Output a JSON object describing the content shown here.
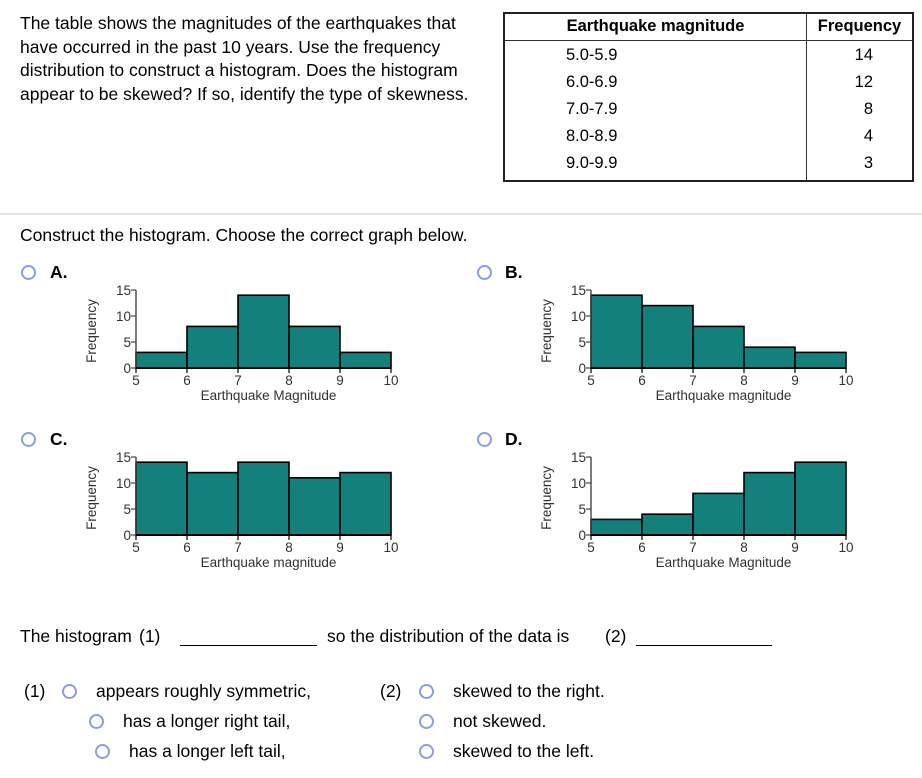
{
  "question": {
    "intro": "The table shows the magnitudes of the earthquakes that have occurred in the past 10 years. Use the frequency distribution to construct a histogram. Does the histogram appear to be skewed? If so, identify the type of skewness.",
    "instruction": "Construct the histogram. Choose the correct graph below."
  },
  "table": {
    "headers": [
      "Earthquake magnitude",
      "Frequency"
    ],
    "rows": [
      {
        "magnitude": "5.0-5.9",
        "frequency": "14"
      },
      {
        "magnitude": "6.0-6.9",
        "frequency": "12"
      },
      {
        "magnitude": "7.0-7.9",
        "frequency": "8"
      },
      {
        "magnitude": "8.0-8.9",
        "frequency": "4"
      },
      {
        "magnitude": "9.0-9.9",
        "frequency": "3"
      }
    ]
  },
  "options": [
    {
      "label": "A.",
      "selected": false
    },
    {
      "label": "B.",
      "selected": false
    },
    {
      "label": "C.",
      "selected": false
    },
    {
      "label": "D.",
      "selected": false
    }
  ],
  "chart_data": [
    {
      "type": "bar",
      "option": "A",
      "bin_edges": [
        5,
        6,
        7,
        8,
        9,
        10
      ],
      "values": [
        3,
        8,
        14,
        8,
        3
      ],
      "xlabel": "Earthquake Magnitude",
      "ylabel": "Frequency",
      "xlim": [
        5,
        10
      ],
      "ylim": [
        0,
        15
      ],
      "xticks": [
        "5",
        "6",
        "7",
        "8",
        "9",
        "10"
      ],
      "yticks": [
        "0",
        "5",
        "10",
        "15"
      ],
      "bar_color": "#13807b",
      "grid": false
    },
    {
      "type": "bar",
      "option": "B",
      "bin_edges": [
        5,
        6,
        7,
        8,
        9,
        10
      ],
      "values": [
        14,
        12,
        8,
        4,
        3
      ],
      "xlabel": "Earthquake magnitude",
      "ylabel": "Frequency",
      "xlim": [
        5,
        10
      ],
      "ylim": [
        0,
        15
      ],
      "xticks": [
        "5",
        "6",
        "7",
        "8",
        "9",
        "10"
      ],
      "yticks": [
        "0",
        "5",
        "10",
        "15"
      ],
      "bar_color": "#13807b",
      "grid": false
    },
    {
      "type": "bar",
      "option": "C",
      "bin_edges": [
        5,
        6,
        7,
        8,
        9,
        10
      ],
      "values": [
        14,
        12,
        14,
        11,
        12
      ],
      "xlabel": "Earthquake magnitude",
      "ylabel": "Frequency",
      "xlim": [
        5,
        10
      ],
      "ylim": [
        0,
        15
      ],
      "xticks": [
        "5",
        "6",
        "7",
        "8",
        "9",
        "10"
      ],
      "yticks": [
        "0",
        "5",
        "10",
        "15"
      ],
      "bar_color": "#13807b",
      "grid": false
    },
    {
      "type": "bar",
      "option": "D",
      "bin_edges": [
        5,
        6,
        7,
        8,
        9,
        10
      ],
      "values": [
        3,
        4,
        8,
        12,
        14
      ],
      "xlabel": "Earthquake Magnitude",
      "ylabel": "Frequency",
      "xlim": [
        5,
        10
      ],
      "ylim": [
        0,
        15
      ],
      "xticks": [
        "5",
        "6",
        "7",
        "8",
        "9",
        "10"
      ],
      "yticks": [
        "0",
        "5",
        "10",
        "15"
      ],
      "bar_color": "#13807b",
      "grid": false
    }
  ],
  "sentence": {
    "part1": "The histogram",
    "marker1": "(1)",
    "part2": "so the distribution of the data is",
    "marker2": "(2)"
  },
  "answers": {
    "group1": {
      "marker": "(1)",
      "choices": [
        "appears roughly symmetric,",
        "has a longer right tail,",
        "has a longer left tail,"
      ]
    },
    "group2": {
      "marker": "(2)",
      "choices": [
        "skewed to the right.",
        "not skewed.",
        "skewed to the left."
      ]
    }
  }
}
